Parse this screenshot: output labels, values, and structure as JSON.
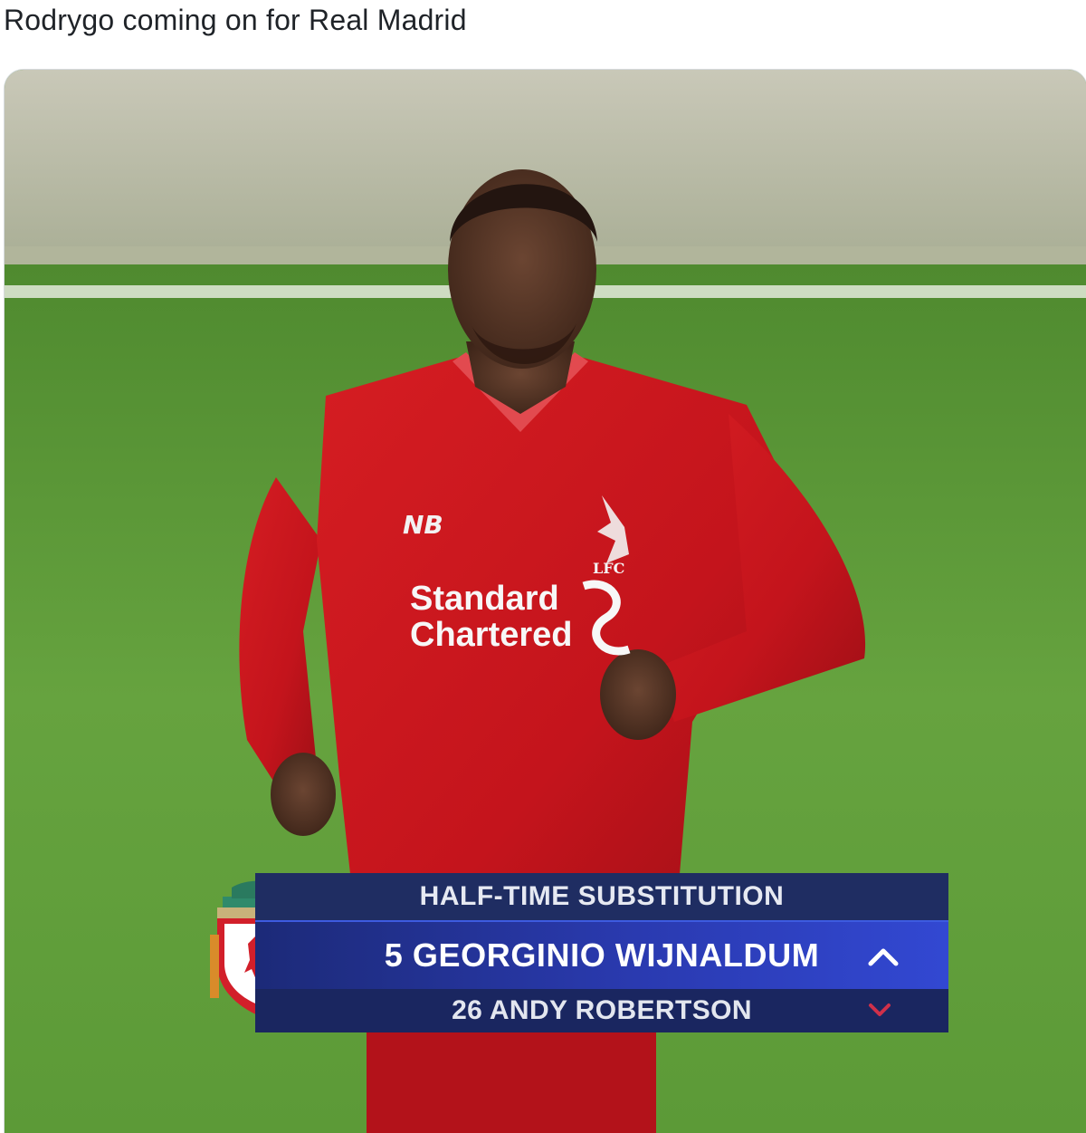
{
  "post": {
    "text": "Rodrygo coming on for Real Madrid"
  },
  "scene": {
    "sponsor_line1": "Standard",
    "sponsor_line2": "Chartered",
    "club_short": "LFC"
  },
  "scorebug": {
    "header": "HALF-TIME SUBSTITUTION",
    "player_in": "5 GEORGINIO WIJNALDUM",
    "player_out": "26 ANDY ROBERTSON",
    "crest_icon": "liverpool-crest-icon",
    "in_icon": "chevron-up-icon",
    "out_icon": "chevron-down-icon"
  },
  "colors": {
    "pitch": "#5d9a3a",
    "shirt": "#c4141c",
    "bug_header": "#1f2d62",
    "bug_in": "#2a3ab0",
    "bug_out": "#1a2660",
    "out_arrow": "#d0304a"
  }
}
